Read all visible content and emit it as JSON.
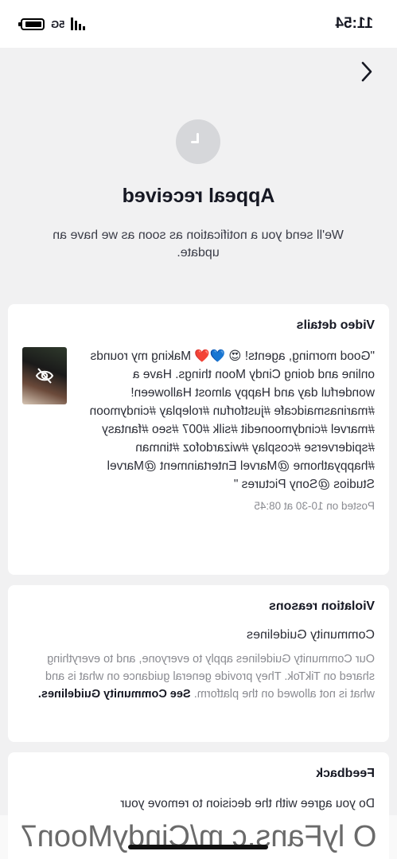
{
  "status_bar": {
    "time": "11:54",
    "network": "5G",
    "battery_level": 0.9
  },
  "header": {
    "back_icon": "chevron-icon"
  },
  "appeal": {
    "title": "Appeal received",
    "subtitle": "We'll send you a notification as soon as we have an update."
  },
  "video_details": {
    "title": "Video details",
    "caption": "\"Good morning, agents! 😍 💙❤️ Making my rounds online and doing Cindy Moon things. Have a wonderful day and Happy almost Halloween! #marinasmaidcafe #justforfun #roleplay #cindymoon #marvel #cindymoonedit #silk #007 #seo #fantasy #spiderverse #cosplay #wizardofoz #tinman #happyathome @Marvel Entertainment @Marvel Studios @Sony Pictures \"",
    "posted": "Posted on 10-30 at 08:45"
  },
  "violation": {
    "title": "Violation reasons",
    "reason": "Community Guidelines",
    "description": "Our Community Guidelines apply to everyone, and to everything shared on TikTok. They provide general guidance on what is and what is not allowed on the platform.",
    "link": "See Community Guidelines."
  },
  "feedback": {
    "title": "Feedback",
    "question": "Do you agree with the decision to remove your"
  },
  "watermark": "O lyFans.c m/CindyMoon7"
}
